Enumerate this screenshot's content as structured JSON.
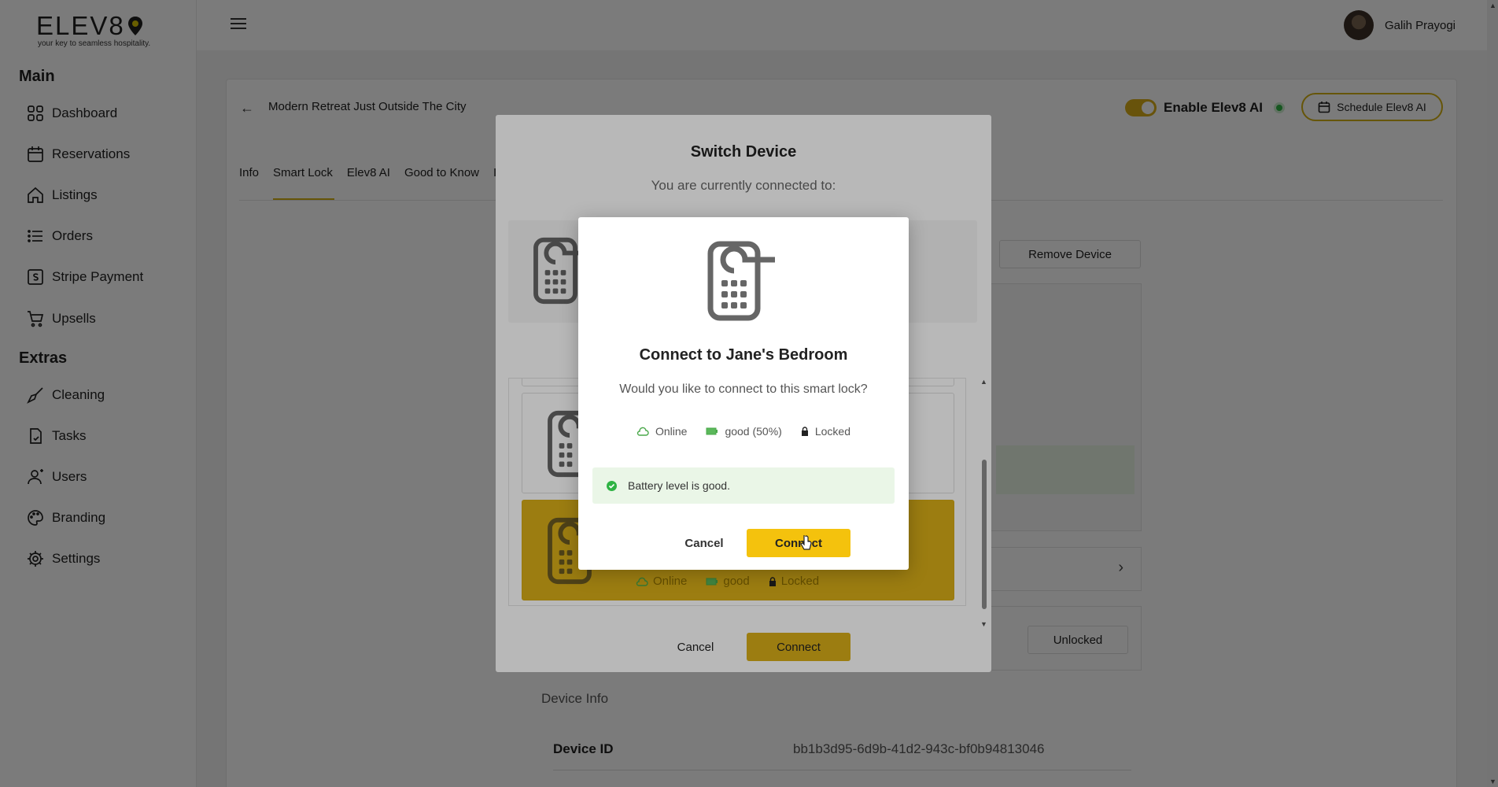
{
  "brand": {
    "logo_text": "ELEV8",
    "tagline": "your key to seamless hospitality."
  },
  "sidebar": {
    "sections": [
      {
        "title": "Main",
        "items": [
          {
            "label": "Dashboard",
            "icon": "grid-icon"
          },
          {
            "label": "Reservations",
            "icon": "calendar-icon"
          },
          {
            "label": "Listings",
            "icon": "home-icon"
          },
          {
            "label": "Orders",
            "icon": "list-icon"
          },
          {
            "label": "Stripe Payment",
            "icon": "stripe-icon"
          },
          {
            "label": "Upsells",
            "icon": "cart-icon"
          }
        ]
      },
      {
        "title": "Extras",
        "items": [
          {
            "label": "Cleaning",
            "icon": "broom-icon"
          },
          {
            "label": "Tasks",
            "icon": "tasks-icon"
          },
          {
            "label": "Users",
            "icon": "users-icon"
          },
          {
            "label": "Branding",
            "icon": "palette-icon"
          },
          {
            "label": "Settings",
            "icon": "gear-icon"
          }
        ]
      }
    ]
  },
  "topbar": {
    "user_name": "Galih Prayogi"
  },
  "listing": {
    "title": "Modern Retreat Just Outside The City",
    "tabs": [
      "Info",
      "Smart Lock",
      "Elev8 AI",
      "Good to Know",
      "I"
    ],
    "active_tab": "Smart Lock",
    "enable_ai_label": "Enable Elev8 AI",
    "schedule_label": "Schedule Elev8 AI",
    "remove_device_label": "Remove Device",
    "unlocked_label": "Unlocked",
    "device_info_title": "Device Info",
    "device_id_label": "Device ID",
    "device_id_value": "bb1b3d95-6d9b-41d2-943c-bf0b94813046"
  },
  "switch_modal": {
    "title": "Switch Device",
    "subtitle": "You are currently connected to:",
    "selected_item_status": {
      "online": "Online",
      "battery": "good",
      "lock": "Locked"
    },
    "cancel_label": "Cancel",
    "connect_label": "Connect"
  },
  "confirm_modal": {
    "title": "Connect to Jane's Bedroom",
    "subtitle": "Would you like to connect to this smart lock?",
    "status": {
      "online": "Online",
      "battery": "good (50%)",
      "lock": "Locked"
    },
    "alert": "Battery level is good.",
    "cancel_label": "Cancel",
    "connect_label": "Connect"
  },
  "colors": {
    "accent": "#d9ad18",
    "confirm_button": "#f4c20d",
    "success": "#2fb344",
    "alert_bg": "#eaf6e7"
  }
}
